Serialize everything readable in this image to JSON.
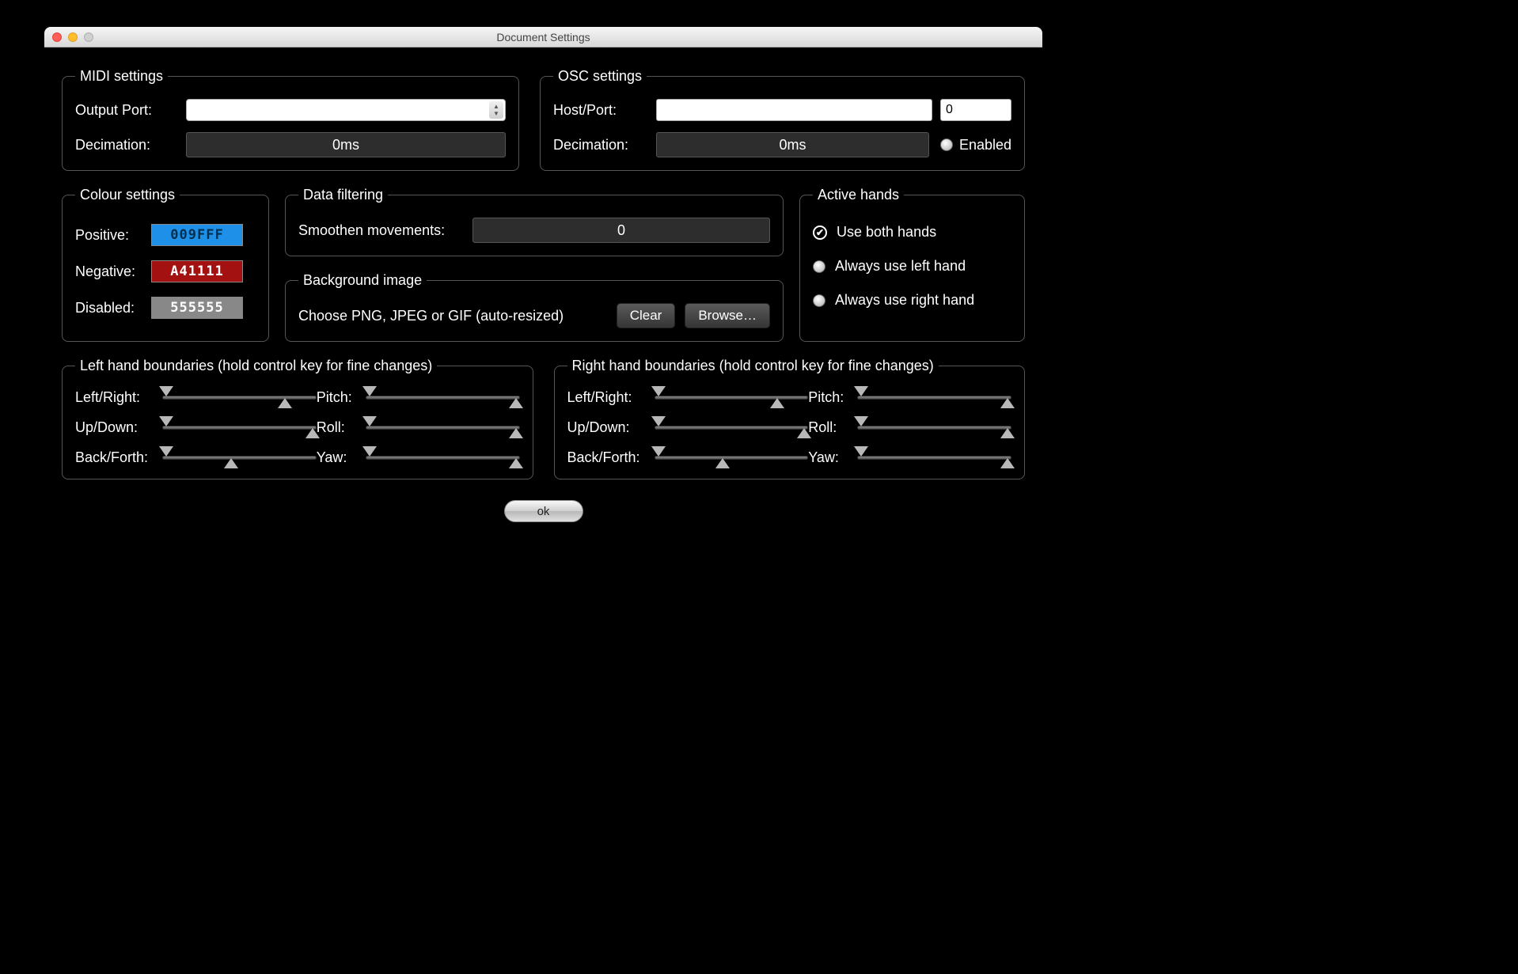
{
  "window": {
    "title": "Document Settings"
  },
  "midi": {
    "legend": "MIDI settings",
    "output_port_label": "Output Port:",
    "decimation_label": "Decimation:",
    "decimation_value": "0ms"
  },
  "osc": {
    "legend": "OSC settings",
    "host_port_label": "Host/Port:",
    "port_value": "0",
    "decimation_label": "Decimation:",
    "decimation_value": "0ms",
    "enabled_label": "Enabled"
  },
  "colour": {
    "legend": "Colour settings",
    "positive_label": "Positive:",
    "positive_value": "009FFF",
    "positive_bg": "#1e90e8",
    "positive_fg": "#003050",
    "negative_label": "Negative:",
    "negative_value": "A41111",
    "negative_bg": "#a41111",
    "negative_fg": "#ffffff",
    "disabled_label": "Disabled:",
    "disabled_value": "555555",
    "disabled_bg": "#888888",
    "disabled_fg": "#ffffff"
  },
  "filter": {
    "legend": "Data filtering",
    "smoothen_label": "Smoothen movements:",
    "smoothen_value": "0"
  },
  "bg": {
    "legend": "Background image",
    "desc": "Choose PNG, JPEG or GIF (auto-resized)",
    "clear": "Clear",
    "browse": "Browse…"
  },
  "hands": {
    "legend": "Active hands",
    "both": "Use both hands",
    "left": "Always use left hand",
    "right": "Always use right hand"
  },
  "lbound": {
    "legend": "Left hand boundaries (hold control key for fine changes)",
    "lr": "Left/Right:",
    "ud": "Up/Down:",
    "bf": "Back/Forth:",
    "pitch": "Pitch:",
    "roll": "Roll:",
    "yaw": "Yaw:"
  },
  "rbound": {
    "legend": "Right hand boundaries (hold control key for fine changes)",
    "lr": "Left/Right:",
    "ud": "Up/Down:",
    "bf": "Back/Forth:",
    "pitch": "Pitch:",
    "roll": "Roll:",
    "yaw": "Yaw:"
  },
  "ok": "ok"
}
